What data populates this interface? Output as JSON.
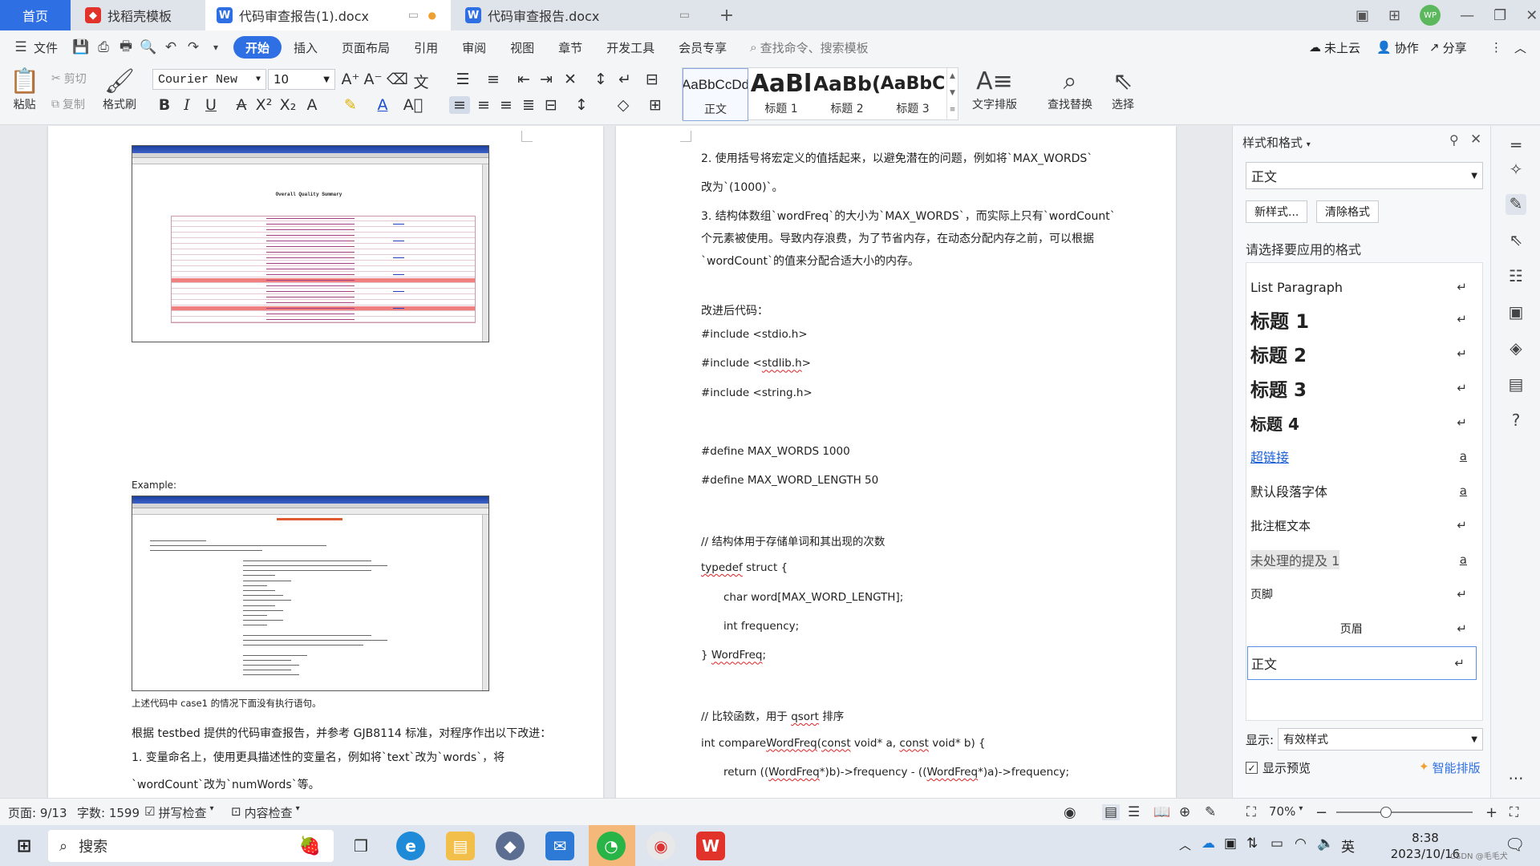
{
  "tabs": {
    "home": "首页",
    "daoke": "找稻壳模板",
    "doc1": "代码审查报告(1).docx",
    "doc2": "代码审查报告.docx",
    "new_tab": "+"
  },
  "menu": {
    "file": "文件",
    "items": [
      "开始",
      "插入",
      "页面布局",
      "引用",
      "审阅",
      "视图",
      "章节",
      "开发工具",
      "会员专享"
    ],
    "search_placeholder": "查找命令、搜索模板",
    "not_cloud": "未上云",
    "collab": "协作",
    "share": "分享"
  },
  "ribbon": {
    "paste": "粘贴",
    "cut": "剪切",
    "copy": "复制",
    "format_painter": "格式刷",
    "font_name": "Courier New",
    "font_size": "10",
    "styles": [
      {
        "preview": "AaBbCcDd",
        "label": "正文"
      },
      {
        "preview": "AaBl",
        "label": "标题 1"
      },
      {
        "preview": "AaBb(",
        "label": "标题 2"
      },
      {
        "preview": "AaBbC",
        "label": "标题 3"
      }
    ],
    "text_layout": "文字排版",
    "find_replace": "查找替换",
    "select": "选择"
  },
  "doc_left": {
    "fig1_title": "Overall Quality Summary",
    "example_label": "Example:",
    "fig_caption": "上述代码中 case1 的情况下面没有执行语句。",
    "para1": "根据 testbed 提供的代码审查报告，并参考 GJB8114 标准，对程序作出以下改进：",
    "item1": "1. 变量命名上，使用更具描述性的变量名，例如将`text`改为`words`，将",
    "item1b": "`wordCount`改为`numWords`等。"
  },
  "doc_right": {
    "item2": "2. 使用括号将宏定义的值括起来，以避免潜在的问题，例如将`MAX_WORDS`",
    "item2b": "改为`(1000)`。",
    "item3": "3. 结构体数组`wordFreq`的大小为`MAX_WORDS`，而实际上只有`wordCount`",
    "item3b": "个元素被使用。导致内存浪费，为了节省内存，在动态分配内存之前，可以根据",
    "item3c": "`wordCount`的值来分配合适大小的内存。",
    "improved": "改进后代码：",
    "code": [
      "#include <stdio.h>",
      "#include <stdlib.h>",
      "#include <string.h>",
      "",
      "#define MAX_WORDS 1000",
      "#define MAX_WORD_LENGTH 50",
      "",
      "// 结构体用于存储单词和其出现的次数",
      "typedef struct {",
      "    char word[MAX_WORD_LENGTH];",
      "    int frequency;",
      "} WordFreq;",
      "",
      "// 比较函数，用于 qsort 排序",
      "int compareWordFreq(const void* a, const void* b) {",
      "    return ((WordFreq*)b)->frequency - ((WordFreq*)a)->frequency;"
    ]
  },
  "style_panel": {
    "title": "样式和格式",
    "current_style": "正文",
    "new_style": "新样式...",
    "clear_format": "清除格式",
    "choose_label": "请选择要应用的格式",
    "styles": [
      {
        "name": "List Paragraph",
        "mark": "↵"
      },
      {
        "name": "标题 1",
        "mark": "↵"
      },
      {
        "name": "标题 2",
        "mark": "↵"
      },
      {
        "name": "标题 3",
        "mark": "↵"
      },
      {
        "name": "标题 4",
        "mark": "↵"
      },
      {
        "name": "超链接",
        "mark": "a"
      },
      {
        "name": "默认段落字体",
        "mark": "a"
      },
      {
        "name": "批注框文本",
        "mark": "↵"
      },
      {
        "name": "未处理的提及 1",
        "mark": "a"
      },
      {
        "name": "页脚",
        "mark": "↵"
      },
      {
        "name": "页眉",
        "mark": "↵"
      },
      {
        "name": "正文",
        "mark": "↵"
      }
    ],
    "show_label": "显示:",
    "show_value": "有效样式",
    "preview_label": "显示预览",
    "smart_layout": "智能排版"
  },
  "status": {
    "page": "页面: 9/13",
    "words": "字数: 1599",
    "spell": "拼写检查",
    "content_check": "内容检查",
    "zoom": "70%"
  },
  "taskbar": {
    "search": "搜索",
    "time": "8:38",
    "date": "2023/10/16",
    "ime": "英",
    "watermark": "CSDN @毛毛犬"
  },
  "colors": {
    "accent": "#2f6fe4",
    "highlight_row": "#f08080"
  }
}
